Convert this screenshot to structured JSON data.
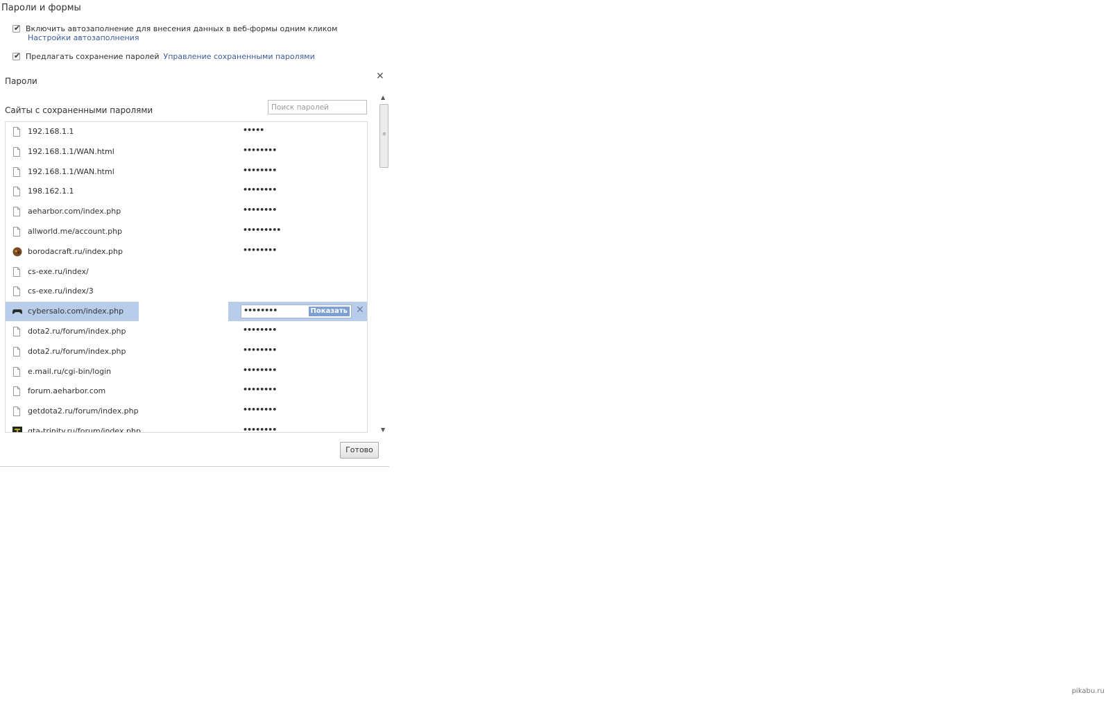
{
  "section_title": "Пароли и формы",
  "autofill": {
    "checkbox_label": "Включить автозаполнение для внесения данных в веб-формы одним кликом",
    "settings_link": "Настройки автозаполнения",
    "checked": true
  },
  "save_passwords": {
    "checkbox_label": "Предлагать сохранение паролей",
    "manage_link": "Управление сохраненными паролями",
    "checked": true
  },
  "dialog": {
    "title": "Пароли",
    "close_icon": "close-icon",
    "subtitle": "Сайты с сохраненными паролями",
    "search_placeholder": "Поиск паролей",
    "done_label": "Готово",
    "show_label": "Показать",
    "rows": [
      {
        "site": "192.168.1.1",
        "password": "•••••",
        "icon": "page-icon"
      },
      {
        "site": "192.168.1.1/WAN.html",
        "password": "••••••••",
        "icon": "page-icon"
      },
      {
        "site": "192.168.1.1/WAN.html",
        "password": "••••••••",
        "icon": "page-icon"
      },
      {
        "site": "198.162.1.1",
        "password": "••••••••",
        "icon": "page-icon"
      },
      {
        "site": "aeharbor.com/index.php",
        "password": "••••••••",
        "icon": "page-icon"
      },
      {
        "site": "allworld.me/account.php",
        "password": "•••••••••",
        "icon": "page-icon"
      },
      {
        "site": "borodacraft.ru/index.php",
        "password": "••••••••",
        "icon": "borodacraft-favicon"
      },
      {
        "site": "cs-exe.ru/index/",
        "password": "",
        "icon": "page-icon"
      },
      {
        "site": "cs-exe.ru/index/3",
        "password": "",
        "icon": "page-icon"
      },
      {
        "site": "cybersalo.com/index.php",
        "password": "••••••••",
        "icon": "gamepad-icon",
        "selected": true
      },
      {
        "site": "dota2.ru/forum/index.php",
        "password": "••••••••",
        "icon": "page-icon"
      },
      {
        "site": "dota2.ru/forum/index.php",
        "password": "••••••••",
        "icon": "page-icon"
      },
      {
        "site": "e.mail.ru/cgi-bin/login",
        "password": "••••••••",
        "icon": "page-icon"
      },
      {
        "site": "forum.aeharbor.com",
        "password": "••••••••",
        "icon": "page-icon"
      },
      {
        "site": "getdota2.ru/forum/index.php",
        "password": "••••••••",
        "icon": "page-icon"
      },
      {
        "site": "gta-trinity.ru/forum/index.php",
        "password": "••••••••",
        "icon": "trinity-favicon"
      }
    ]
  },
  "watermark": "pikabu.ru"
}
